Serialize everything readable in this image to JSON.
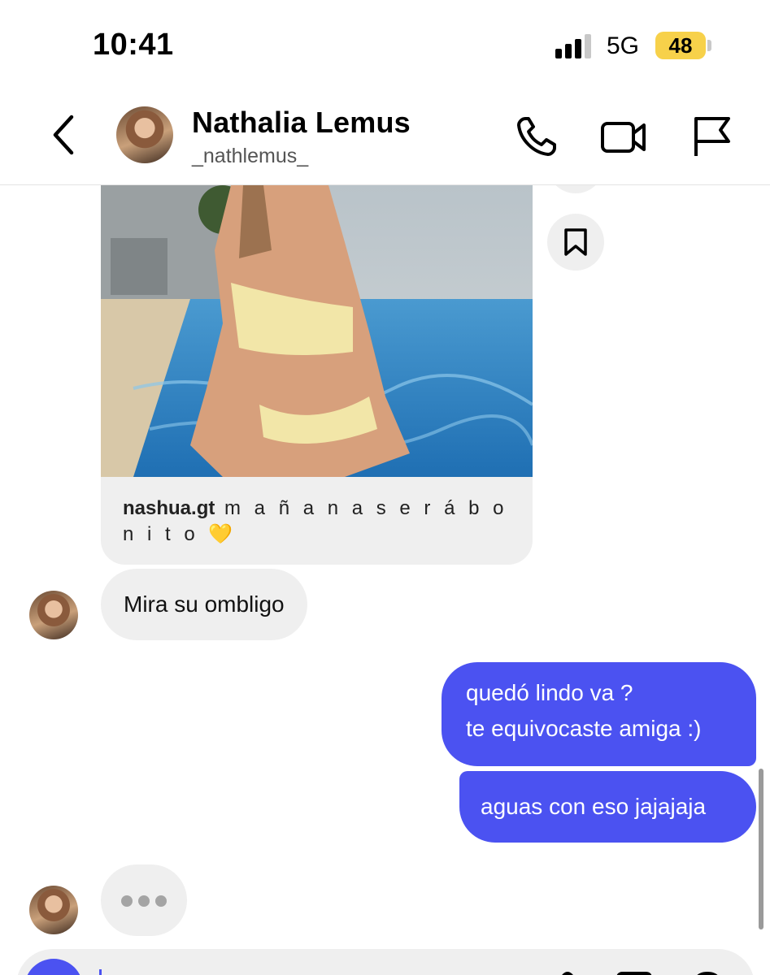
{
  "status_bar": {
    "time": "10:41",
    "network": "5G",
    "battery": "48",
    "battery_color": "#f7d14a"
  },
  "header": {
    "name": "Nathalia Lemus",
    "username": "_nathlemus_",
    "icons": [
      "back-chevron-icon",
      "phone-icon",
      "video-camera-icon",
      "flag-icon"
    ]
  },
  "chat": {
    "shared_post": {
      "username": "nashua.gt",
      "caption": " m a  ñ a n a  s e r á  b o n i t o ",
      "emoji": "💛"
    },
    "side_actions": [
      "more-icon",
      "bookmark-icon"
    ],
    "incoming": [
      {
        "text": "Mira su ombligo"
      }
    ],
    "outgoing": [
      {
        "line1": "quedó lindo va ?",
        "line2": "te equivocaste amiga :)"
      },
      {
        "text": "aguas con eso jajajaja"
      }
    ],
    "typing_indicator": "•••",
    "accent_color": "#4b52f1"
  },
  "composer": {
    "icons": [
      "camera-icon",
      "microphone-icon",
      "image-icon",
      "sticker-icon"
    ]
  }
}
